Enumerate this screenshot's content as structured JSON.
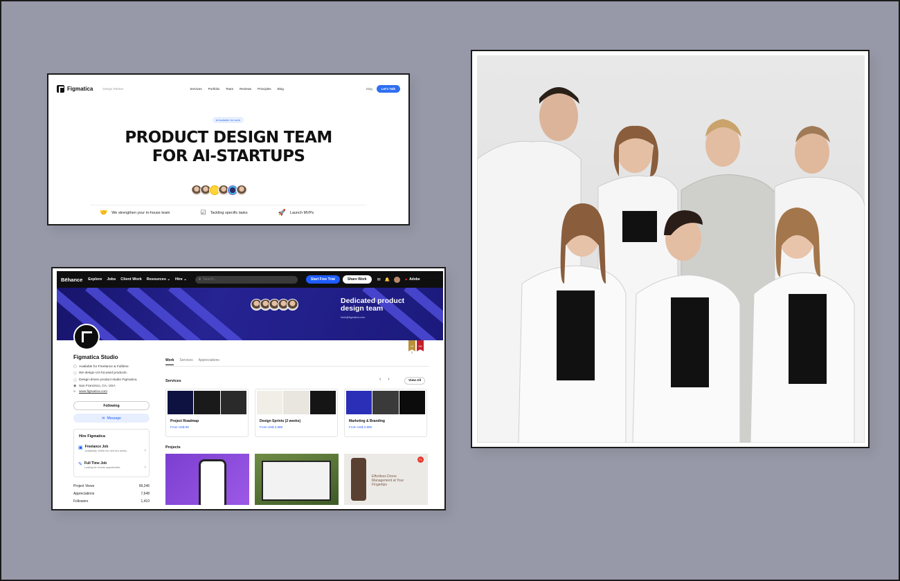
{
  "figmatica_site": {
    "logo": "Figmatica",
    "tagline": "Design Partner",
    "nav_links": [
      "Services",
      "Portfolio",
      "Team",
      "Reviews",
      "Principles",
      "Blog"
    ],
    "sign_in": "Sing",
    "cta": "Let's Talk",
    "available_badge": "● Available for work",
    "headline_line1": "PRODUCT DESIGN TEAM",
    "headline_line2": "FOR AI-STARTUPS",
    "features": [
      {
        "label": "We strengthen your in-house team",
        "icon": "handshake-icon"
      },
      {
        "label": "Tackling specific tasks",
        "icon": "checklist-icon"
      },
      {
        "label": "Launch MVPs",
        "icon": "rocket-icon"
      }
    ]
  },
  "behance": {
    "nav": {
      "brand": "Bēhance",
      "links": [
        "Explore",
        "Jobs",
        "Client Work",
        "Resources ⌄",
        "Hire ⌄"
      ],
      "search_placeholder": "Search...",
      "trial": "Start Free Trial",
      "share": "Share Work",
      "adobe": "Adobe"
    },
    "banner": {
      "title": "Dedicated product design team",
      "email": "hello@figmatica.com"
    },
    "profile": {
      "name": "Figmatica Studio",
      "info": [
        "Available for Freelance & Fulltime",
        "We design UX-focused products.",
        "Design-driven product studio Figmatica.",
        "San Francisco, CA, USA",
        "www.figmatica.com"
      ],
      "following": "Following",
      "message": "Message",
      "hire_title": "Hire Figmatica",
      "hire_options": [
        {
          "title": "Freelance Job",
          "subtitle": "Availability: Within the next few weeks"
        },
        {
          "title": "Full Time Job",
          "subtitle": "Looking for remote opportunities"
        }
      ],
      "stats": [
        {
          "label": "Project Views",
          "value": "99,246"
        },
        {
          "label": "Appreciations",
          "value": "7,648"
        },
        {
          "label": "Followers",
          "value": "1,410"
        }
      ]
    },
    "tabs": [
      "Work",
      "Services",
      "Appreciations"
    ],
    "awards": [
      "UI",
      "XD"
    ],
    "award_count": "3",
    "services_title": "Services",
    "view_all": "View All",
    "services": [
      {
        "title": "Project Roadmap",
        "price": "From US$ 99"
      },
      {
        "title": "Design Sprints (2 weeks)",
        "price": "From US$ 2,999"
      },
      {
        "title": "Marketing & Branding",
        "price": "From US$ 2,999"
      }
    ],
    "projects_title": "Projects",
    "project3_text": "Effortless Drone Management at Your Fingertips",
    "project3_badge": "P1"
  }
}
